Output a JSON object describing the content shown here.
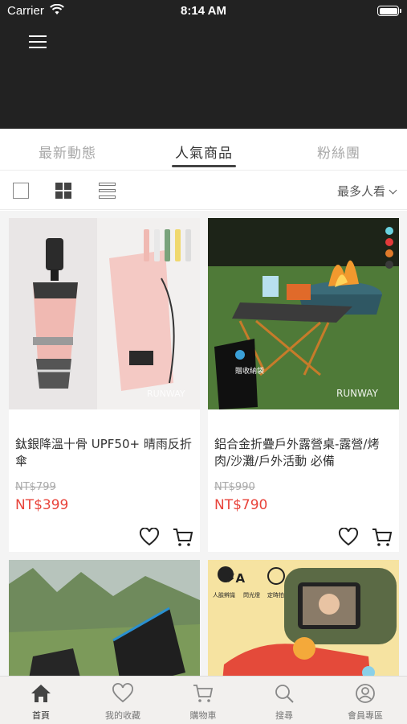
{
  "status_bar": {
    "carrier": "Carrier",
    "time": "8:14 AM"
  },
  "tabs": [
    {
      "label": "最新動態",
      "active": false
    },
    {
      "label": "人氣商品",
      "active": true
    },
    {
      "label": "粉絲團",
      "active": false
    }
  ],
  "toolbar": {
    "sort_label": "最多人看"
  },
  "products": [
    {
      "name": "鈦銀降溫十骨 UPF50+ 晴雨反折傘",
      "original_price": "NT$799",
      "price": "NT$399",
      "image_watermark": "RUNWAY"
    },
    {
      "name": "鋁合金折疊戶外露營桌-露營/烤肉/沙灘/戶外活動 必備",
      "original_price": "NT$990",
      "price": "NT$790",
      "image_watermark": "RUNWAY",
      "image_badge": "贈收納袋"
    },
    {
      "name": "",
      "original_price": "",
      "price": ""
    },
    {
      "name": "",
      "original_price": "",
      "price": "",
      "image_labels": [
        "人臉辨識",
        "閃光燈",
        "定時拍照"
      ]
    }
  ],
  "bottom_nav": [
    {
      "label": "首頁",
      "icon": "home-icon",
      "active": true
    },
    {
      "label": "我的收藏",
      "icon": "heart-icon",
      "active": false
    },
    {
      "label": "購物車",
      "icon": "cart-icon",
      "active": false
    },
    {
      "label": "搜尋",
      "icon": "search-icon",
      "active": false
    },
    {
      "label": "會員專區",
      "icon": "user-icon",
      "active": false
    }
  ],
  "colors": {
    "header_bg": "#222222",
    "price": "#e8433a",
    "tab_active": "#333333",
    "tab_inactive": "#a8a8a8"
  }
}
